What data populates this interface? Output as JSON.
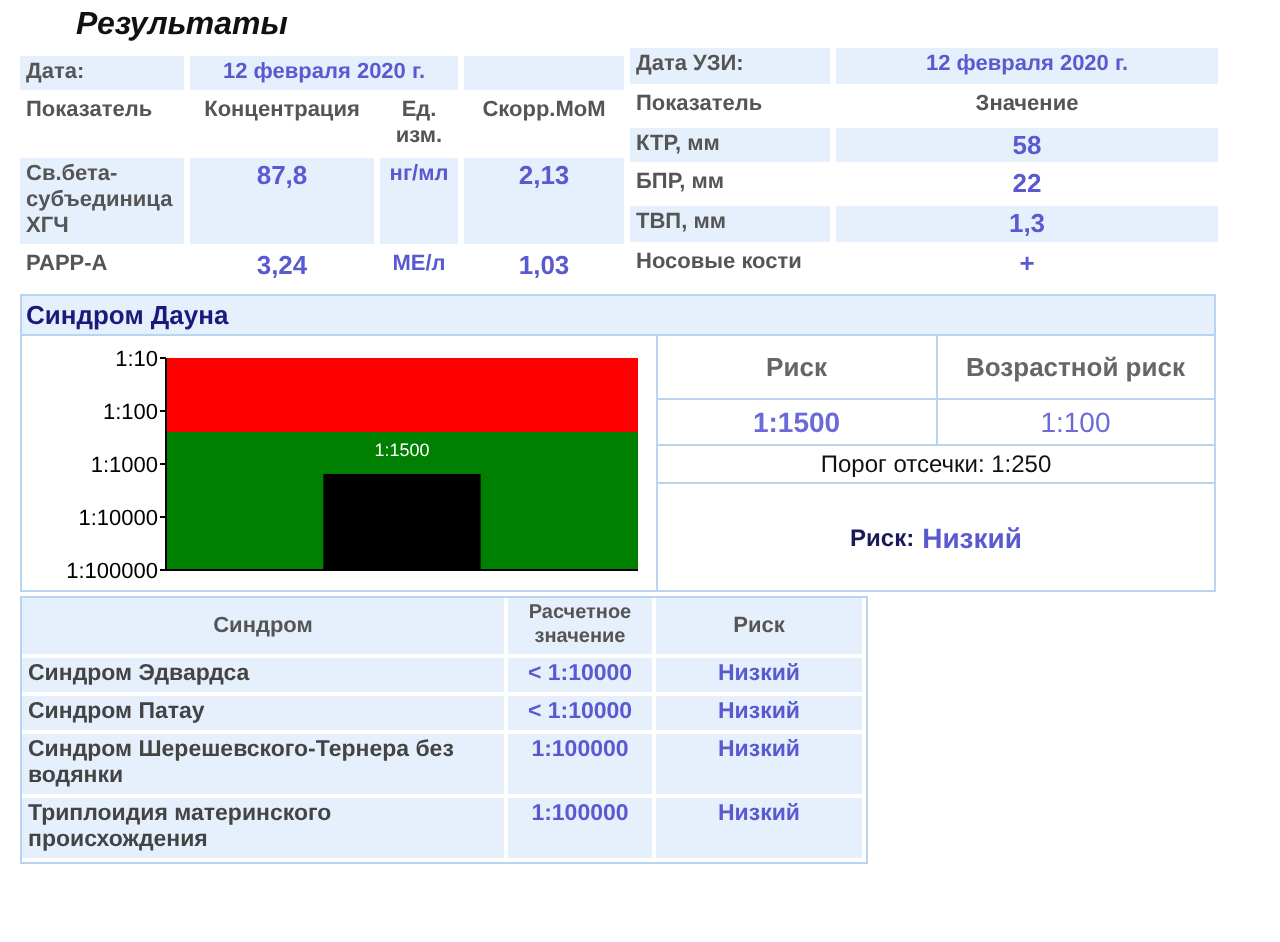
{
  "title": "Результаты",
  "lab": {
    "date_label": "Дата:",
    "date": "12 февраля 2020 г.",
    "columns": [
      "Показатель",
      "Концентрация",
      "Ед. изм.",
      "Скорр.МоМ"
    ],
    "rows": [
      {
        "name": "Св.бета-субъединица ХГЧ",
        "value": "87,8",
        "unit": "нг/мл",
        "mom": "2,13"
      },
      {
        "name": "PAPP-A",
        "value": "3,24",
        "unit": "МЕ/л",
        "mom": "1,03"
      }
    ]
  },
  "ultrasound": {
    "date_label": "Дата УЗИ:",
    "date": "12 февраля 2020 г.",
    "columns": [
      "Показатель",
      "Значение"
    ],
    "rows": [
      {
        "name": "КТР, мм",
        "value": "58"
      },
      {
        "name": "БПР, мм",
        "value": "22"
      },
      {
        "name": "ТВП, мм",
        "value": "1,3"
      },
      {
        "name": "Носовые кости",
        "value": "+"
      }
    ]
  },
  "down": {
    "title": "Синдром Дауна",
    "chart": {
      "kind": "risk-chart",
      "axis_labels": [
        "1:10",
        "1:100",
        "1:1000",
        "1:10000",
        "1:100000"
      ],
      "bar_label": "1:1500"
    },
    "risk_header": "Риск",
    "age_risk_header": "Возрастной риск",
    "risk": "1:1500",
    "age_risk": "1:100",
    "cutoff": "Порог отсечки: 1:250",
    "verdict_label": "Риск:",
    "verdict": "Низкий"
  },
  "others": {
    "columns": [
      "Синдром",
      "Расчетное значение",
      "Риск"
    ],
    "rows": [
      {
        "name": "Синдром Эдвардса",
        "value": "< 1:10000",
        "risk": "Низкий"
      },
      {
        "name": "Синдром Патау",
        "value": "< 1:10000",
        "risk": "Низкий"
      },
      {
        "name": "Синдром Шерешевского-Тернера без водянки",
        "value": "1:100000",
        "risk": "Низкий"
      },
      {
        "name": "Триплоидия материнского происхождения",
        "value": "1:100000",
        "risk": "Низкий"
      }
    ]
  }
}
